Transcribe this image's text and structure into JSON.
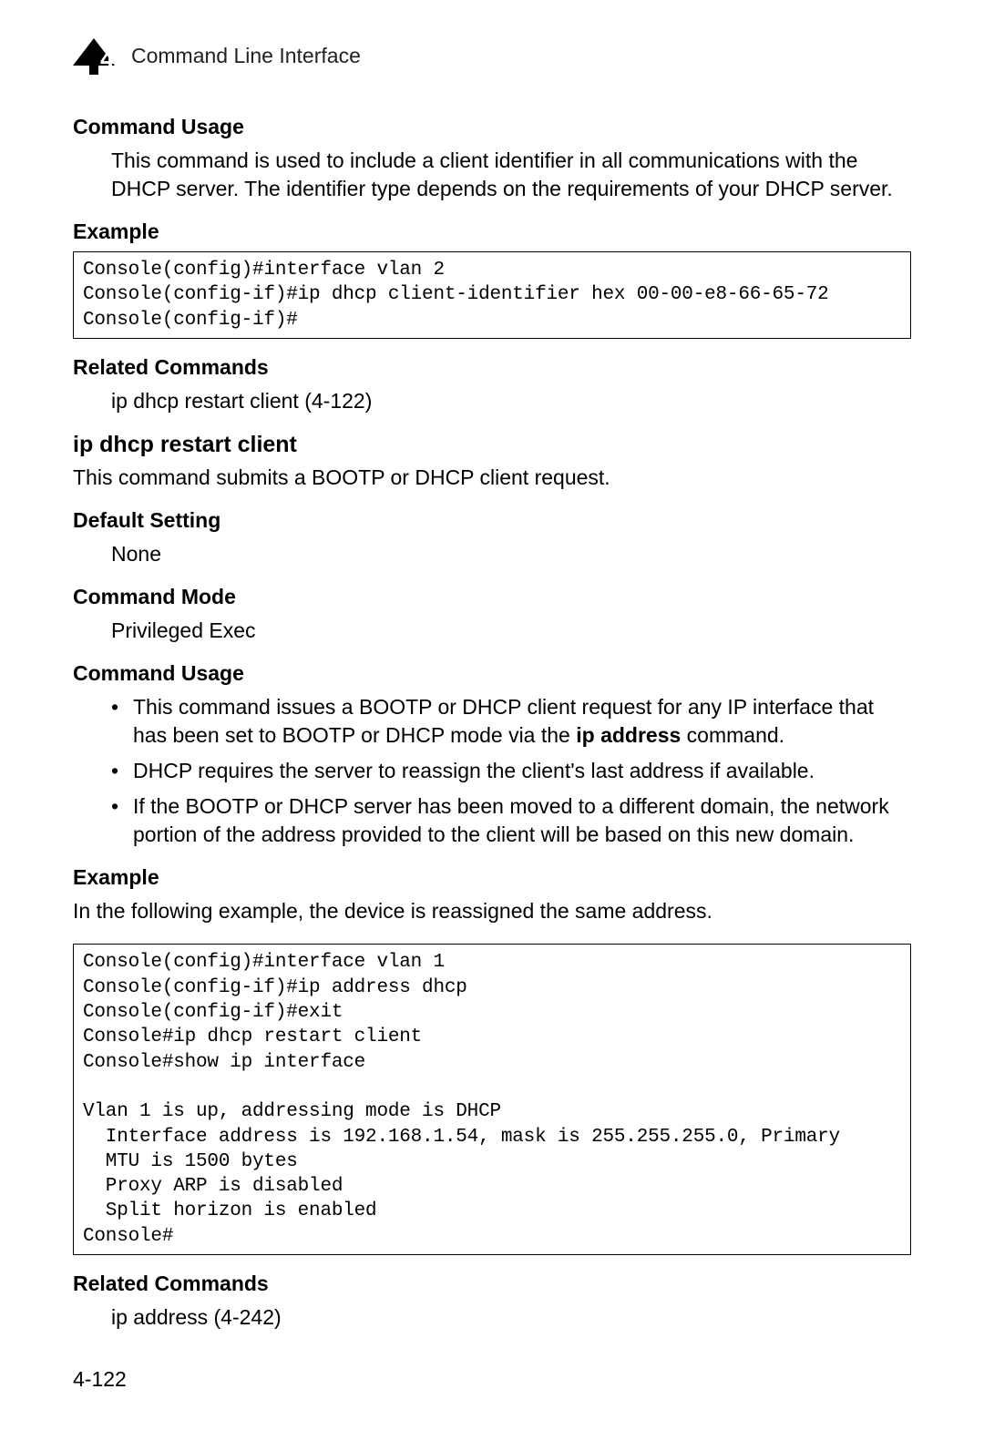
{
  "header": {
    "chapter_number": "4",
    "title": "Command Line Interface"
  },
  "sec1": {
    "heading": "Command Usage",
    "body": "This command is used to include a client identifier in all communications with the DHCP server. The identifier type depends on the requirements of your DHCP server."
  },
  "sec2": {
    "heading": "Example",
    "code": "Console(config)#interface vlan 2\nConsole(config-if)#ip dhcp client-identifier hex 00-00-e8-66-65-72\nConsole(config-if)#"
  },
  "sec3": {
    "heading": "Related Commands",
    "body": "ip dhcp restart client (4-122)"
  },
  "cmd": {
    "title": "ip dhcp restart client",
    "desc": "This command submits a BOOTP or DHCP client request."
  },
  "sec4": {
    "heading": "Default Setting",
    "body": "None"
  },
  "sec5": {
    "heading": "Command Mode",
    "body": "Privileged Exec"
  },
  "sec6": {
    "heading": "Command Usage",
    "bullets": {
      "b1_pre": "This command issues a BOOTP or DHCP client request for any IP interface that has been set to BOOTP or DHCP mode via the ",
      "b1_bold": "ip address",
      "b1_post": " command.",
      "b2": "DHCP requires the server to reassign the client's last address if available.",
      "b3": "If the BOOTP or DHCP server has been moved to a different domain, the network portion of the address provided to the client will be based on this new domain."
    }
  },
  "sec7": {
    "heading": "Example",
    "intro": "In the following example, the device is reassigned the same address.",
    "code": "Console(config)#interface vlan 1\nConsole(config-if)#ip address dhcp\nConsole(config-if)#exit\nConsole#ip dhcp restart client\nConsole#show ip interface\n\nVlan 1 is up, addressing mode is DHCP\n  Interface address is 192.168.1.54, mask is 255.255.255.0, Primary\n  MTU is 1500 bytes\n  Proxy ARP is disabled\n  Split horizon is enabled\nConsole#"
  },
  "sec8": {
    "heading": "Related Commands",
    "body": "ip address (4-242)"
  },
  "page_number": "4-122"
}
